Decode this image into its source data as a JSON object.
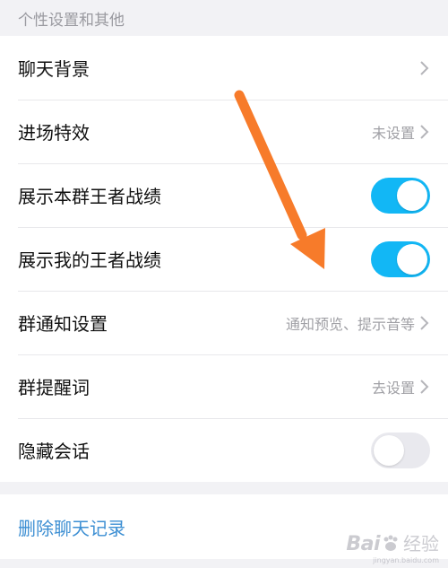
{
  "section_header": "个性设置和其他",
  "rows": [
    {
      "label": "聊天背景",
      "value": "",
      "type": "link"
    },
    {
      "label": "进场特效",
      "value": "未设置",
      "type": "link"
    },
    {
      "label": "展示本群王者战绩",
      "type": "toggle",
      "state": "on"
    },
    {
      "label": "展示我的王者战绩",
      "type": "toggle",
      "state": "on"
    },
    {
      "label": "群通知设置",
      "value": "通知预览、提示音等",
      "type": "link"
    },
    {
      "label": "群提醒词",
      "value": "去设置",
      "type": "link"
    },
    {
      "label": "隐藏会话",
      "type": "toggle",
      "state": "off"
    }
  ],
  "delete_history": "删除聊天记录",
  "watermark": {
    "brand": "Bai",
    "suffix": "经验",
    "url": "jingyan.baidu.com"
  },
  "colors": {
    "toggle_on": "#12b7f5",
    "link_blue": "#3d8fd3",
    "arrow": "#f77b2a",
    "bg": "#f2f2f5"
  }
}
